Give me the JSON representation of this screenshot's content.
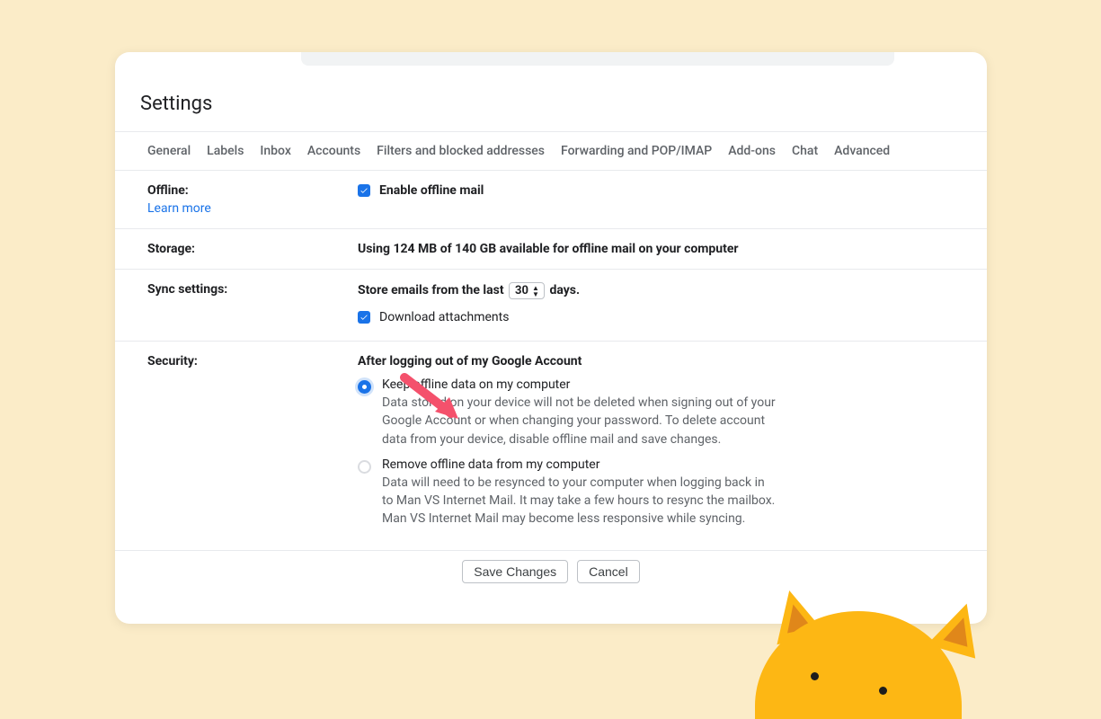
{
  "title": "Settings",
  "tabs": {
    "general": "General",
    "labels": "Labels",
    "inbox": "Inbox",
    "accounts": "Accounts",
    "filters": "Filters and blocked addresses",
    "forwarding": "Forwarding and POP/IMAP",
    "addons": "Add-ons",
    "chat": "Chat",
    "advanced": "Advanced"
  },
  "offline": {
    "label": "Offline:",
    "learn_more": "Learn more",
    "enable_label": "Enable offline mail"
  },
  "storage": {
    "label": "Storage:",
    "text": "Using 124 MB of 140 GB available for offline mail on your computer"
  },
  "sync": {
    "label": "Sync settings:",
    "text_before": "Store emails from the last",
    "value": "30",
    "text_after": "days.",
    "download_label": "Download attachments"
  },
  "security": {
    "label": "Security:",
    "heading": "After logging out of my Google Account",
    "opt1_title": "Keep offline data on my computer",
    "opt1_desc": "Data stored on your device will not be deleted when signing out of your Google Account or when changing your password. To delete account data from your device, disable offline mail and save changes.",
    "opt2_title": "Remove offline data from my computer",
    "opt2_desc": "Data will need to be resynced to your computer when logging back in to Man VS Internet Mail. It may take a few hours to resync the mailbox. Man VS Internet Mail may become less responsive while syncing."
  },
  "buttons": {
    "save": "Save Changes",
    "cancel": "Cancel"
  }
}
